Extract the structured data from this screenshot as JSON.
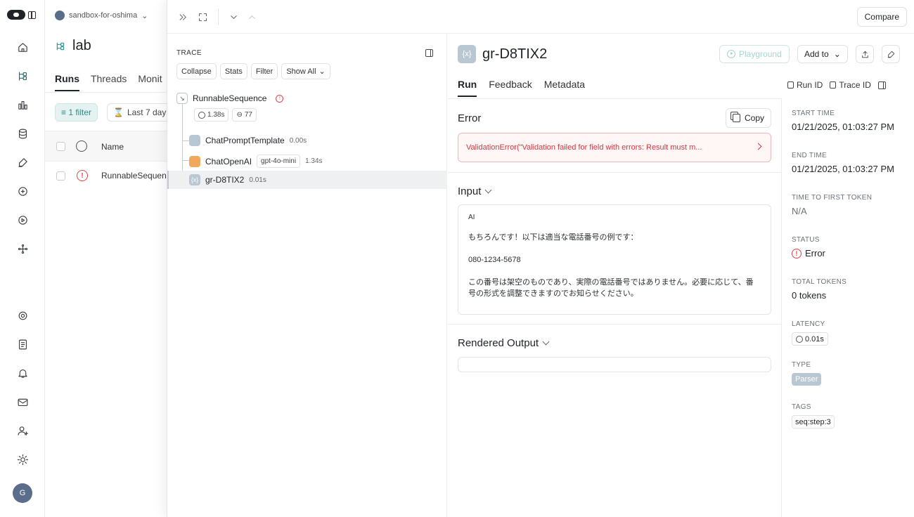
{
  "workspace": {
    "name": "sandbox-for-oshima"
  },
  "project": {
    "title": "lab",
    "tabs": [
      "Runs",
      "Threads",
      "Monit"
    ],
    "filter_label": "1 filter",
    "date_label": "Last 7 day",
    "table": {
      "name_header": "Name",
      "rows": [
        {
          "name": "RunnableSequence"
        }
      ]
    }
  },
  "avatar_initial": "G",
  "topbar": {
    "compare_label": "Compare"
  },
  "trace": {
    "label": "TRACE",
    "buttons": {
      "collapse": "Collapse",
      "stats": "Stats",
      "filter": "Filter",
      "show_all": "Show All"
    },
    "root": {
      "name": "RunnableSequence",
      "latency": "1.38s",
      "tokens": "77"
    },
    "children": [
      {
        "name": "ChatPromptTemplate",
        "duration": "0.00s"
      },
      {
        "name": "ChatOpenAI",
        "model": "gpt-4o-mini",
        "duration": "1.34s"
      },
      {
        "name": "gr-D8TIX2",
        "duration": "0.01s"
      }
    ]
  },
  "run": {
    "title": "gr-D8TIX2",
    "badge": "{x}",
    "tabs": {
      "run": "Run",
      "feedback": "Feedback",
      "metadata": "Metadata"
    },
    "playground_label": "Playground",
    "add_to_label": "Add to",
    "run_id_label": "Run ID",
    "trace_id_label": "Trace ID",
    "error": {
      "title": "Error",
      "copy_label": "Copy",
      "message": "ValidationError(\"Validation failed for field with errors: Result must m..."
    },
    "input": {
      "title": "Input",
      "role": "AI",
      "lines": [
        "もちろんです！以下は適当な電話番号の例です：",
        "080-1234-5678",
        "この番号は架空のものであり、実際の電話番号ではありません。必要に応じて、番号の形式を調整できますのでお知らせください。"
      ]
    },
    "output": {
      "title": "Rendered Output"
    }
  },
  "metadata": {
    "start_time": {
      "label": "START TIME",
      "value": "01/21/2025, 01:03:27 PM"
    },
    "end_time": {
      "label": "END TIME",
      "value": "01/21/2025, 01:03:27 PM"
    },
    "ttft": {
      "label": "TIME TO FIRST TOKEN",
      "value": "N/A"
    },
    "status": {
      "label": "STATUS",
      "value": "Error"
    },
    "total_tokens": {
      "label": "TOTAL TOKENS",
      "value": "0 tokens"
    },
    "latency": {
      "label": "LATENCY",
      "value": "0.01s"
    },
    "type": {
      "label": "TYPE",
      "value": "Parser"
    },
    "tags": {
      "label": "TAGS",
      "value": "seq:step:3"
    }
  },
  "colors": {
    "accent": "#2a8c86",
    "error": "#e0444b",
    "parser": "#b8c7d2",
    "llm": "#f2a85c"
  }
}
